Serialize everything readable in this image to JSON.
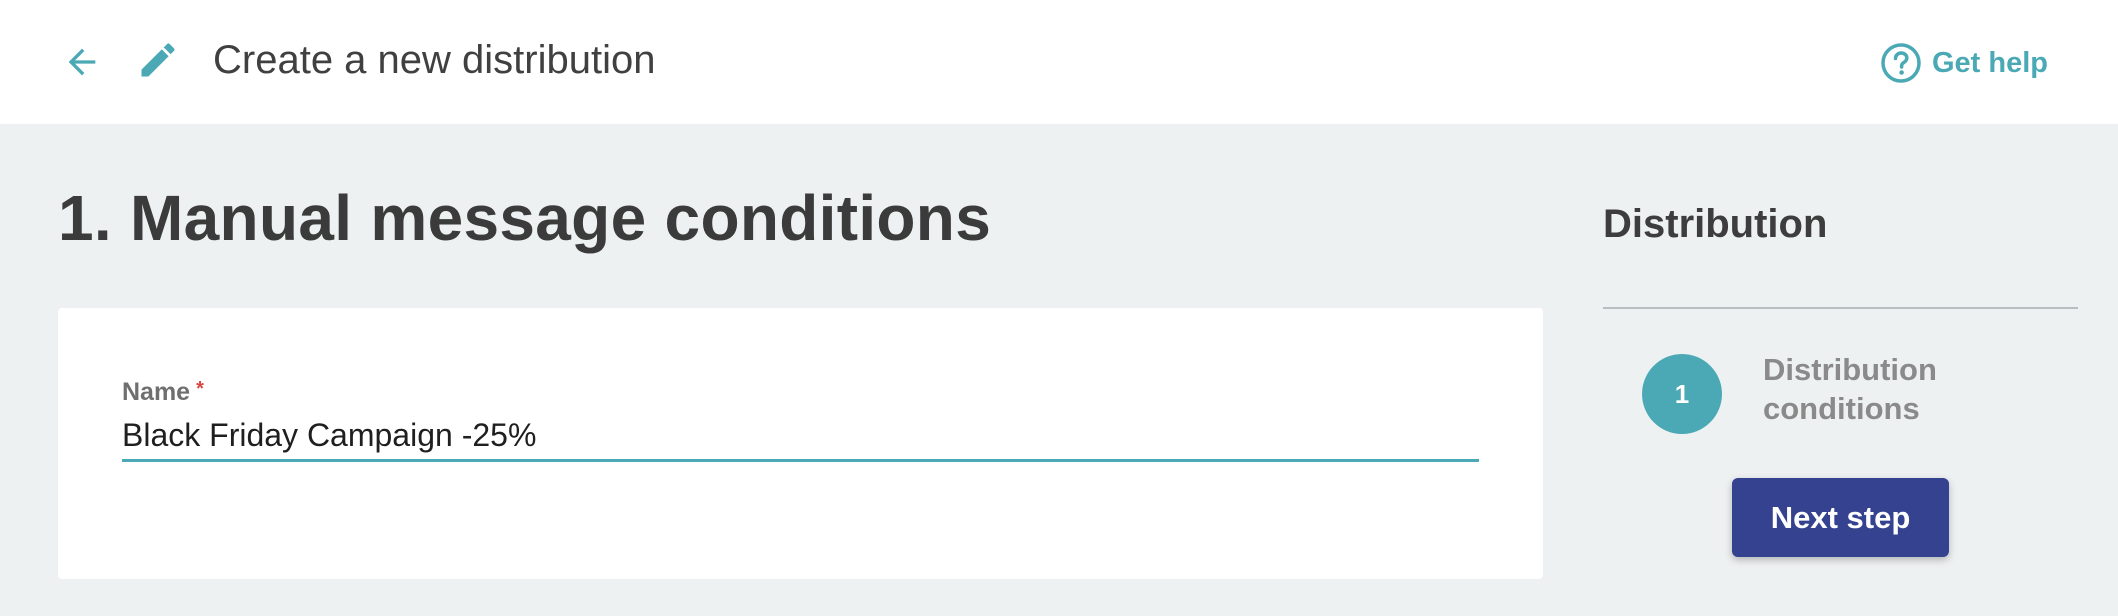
{
  "header": {
    "title": "Create a new distribution",
    "back_icon": "arrow-left-icon",
    "edit_icon": "pencil-icon",
    "help": {
      "label": "Get help",
      "icon": "question-circle-icon"
    }
  },
  "main": {
    "section_title": "1. Manual message conditions",
    "form": {
      "name_label": "Name",
      "required_mark": "*",
      "name_value": "Black Friday Campaign -25%"
    }
  },
  "sidebar": {
    "title": "Distribution",
    "steps": [
      {
        "number": "1",
        "label": "Distribution conditions"
      }
    ],
    "next_button": "Next step"
  },
  "colors": {
    "accent": "#4ba9b5",
    "primary_button": "#34428f",
    "background": "#eef1f2",
    "required": "#d9463f"
  }
}
